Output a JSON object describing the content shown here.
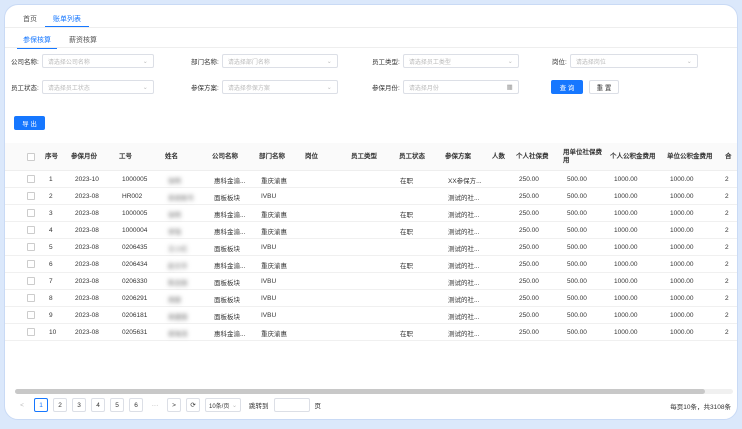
{
  "top_tabs": [
    "首页",
    "账单列表"
  ],
  "sub_tabs": [
    "参保核算",
    "薪资核算"
  ],
  "filters": {
    "company": {
      "label": "公司名称:",
      "placeholder": "请选择公司名称"
    },
    "dept": {
      "label": "部门名称:",
      "placeholder": "请选择部门名称"
    },
    "emp_type": {
      "label": "员工类型:",
      "placeholder": "请选择员工类型"
    },
    "post": {
      "label": "岗位:",
      "placeholder": "请选择岗位"
    },
    "emp_status": {
      "label": "员工状态:",
      "placeholder": "请选择员工状态"
    },
    "scheme": {
      "label": "参保方案:",
      "placeholder": "请选择参保方案"
    },
    "month": {
      "label": "参保月份:",
      "placeholder": "请选择月份"
    }
  },
  "buttons": {
    "query": "查 询",
    "reset": "重 置",
    "export": "导 出"
  },
  "columns": [
    "序号",
    "参保月份",
    "工号",
    "姓名",
    "公司名称",
    "部门名称",
    "岗位",
    "员工类型",
    "员工状态",
    "参保方案",
    "人数",
    "个人社保费",
    "用单位社保费用",
    "个人公积金费用",
    "单位公积金费用",
    "合"
  ],
  "rows": [
    {
      "no": "1",
      "month": "2023-10",
      "id": "1000005",
      "name": "张明",
      "company": "惠科金渝...",
      "dept": "重庆渝惠",
      "status": "在职",
      "scheme": "XX参保方...",
      "p_ss": "250.00",
      "c_ss": "500.00",
      "p_hf": "1000.00",
      "c_hf": "1000.00",
      "last": "2"
    },
    {
      "no": "2",
      "month": "2023-08",
      "id": "HR002",
      "name": "系统账号",
      "company": "面板板块",
      "dept": "IVBU",
      "status": "",
      "scheme": "测试的社...",
      "p_ss": "250.00",
      "c_ss": "500.00",
      "p_hf": "1000.00",
      "c_hf": "1000.00",
      "last": "2"
    },
    {
      "no": "3",
      "month": "2023-08",
      "id": "1000005",
      "name": "张明",
      "company": "惠科金渝...",
      "dept": "重庆渝惠",
      "status": "在职",
      "scheme": "测试的社...",
      "p_ss": "250.00",
      "c_ss": "500.00",
      "p_hf": "1000.00",
      "c_hf": "1000.00",
      "last": "2"
    },
    {
      "no": "4",
      "month": "2023-08",
      "id": "1000004",
      "name": "李强",
      "company": "惠科金渝...",
      "dept": "重庆渝惠",
      "status": "在职",
      "scheme": "测试的社...",
      "p_ss": "250.00",
      "c_ss": "500.00",
      "p_hf": "1000.00",
      "c_hf": "1000.00",
      "last": "2"
    },
    {
      "no": "5",
      "month": "2023-08",
      "id": "0206435",
      "name": "王小红",
      "company": "面板板块",
      "dept": "IVBU",
      "status": "",
      "scheme": "测试的社...",
      "p_ss": "250.00",
      "c_ss": "500.00",
      "p_hf": "1000.00",
      "c_hf": "1000.00",
      "last": "2"
    },
    {
      "no": "6",
      "month": "2023-08",
      "id": "0206434",
      "name": "赵文华",
      "company": "惠科金渝...",
      "dept": "重庆渝惠",
      "status": "在职",
      "scheme": "测试的社...",
      "p_ss": "250.00",
      "c_ss": "500.00",
      "p_hf": "1000.00",
      "c_hf": "1000.00",
      "last": "2"
    },
    {
      "no": "7",
      "month": "2023-08",
      "id": "0206330",
      "name": "陈志刚",
      "company": "面板板块",
      "dept": "IVBU",
      "status": "",
      "scheme": "测试的社...",
      "p_ss": "250.00",
      "c_ss": "500.00",
      "p_hf": "1000.00",
      "c_hf": "1000.00",
      "last": "2"
    },
    {
      "no": "8",
      "month": "2023-08",
      "id": "0206291",
      "name": "周丽",
      "company": "面板板块",
      "dept": "IVBU",
      "status": "",
      "scheme": "测试的社...",
      "p_ss": "250.00",
      "c_ss": "500.00",
      "p_hf": "1000.00",
      "c_hf": "1000.00",
      "last": "2"
    },
    {
      "no": "9",
      "month": "2023-08",
      "id": "0206181",
      "name": "吴建国",
      "company": "面板板块",
      "dept": "IVBU",
      "status": "",
      "scheme": "测试的社...",
      "p_ss": "250.00",
      "c_ss": "500.00",
      "p_hf": "1000.00",
      "c_hf": "1000.00",
      "last": "2"
    },
    {
      "no": "10",
      "month": "2023-08",
      "id": "0205631",
      "name": "郑海涛",
      "company": "惠科金渝...",
      "dept": "重庆渝惠",
      "status": "在职",
      "scheme": "测试的社...",
      "p_ss": "250.00",
      "c_ss": "500.00",
      "p_hf": "1000.00",
      "c_hf": "1000.00",
      "last": "2"
    }
  ],
  "pagination": {
    "pages": [
      "1",
      "2",
      "3",
      "4",
      "5",
      "6"
    ],
    "ellipsis": "···",
    "prev": "<",
    "next": ">",
    "refresh": "⟳",
    "page_size": "10条/页",
    "goto_label": "跳转到",
    "goto_suffix": "页",
    "total": "每页10条，共3108条"
  }
}
